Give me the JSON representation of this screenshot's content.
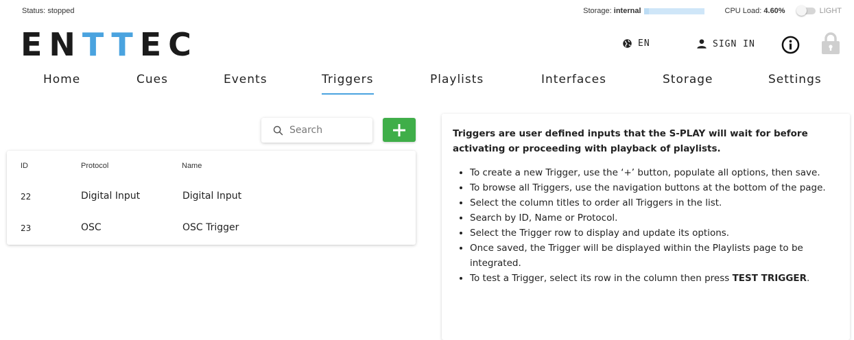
{
  "status": {
    "label": "Status:",
    "value": "stopped",
    "storage_label": "Storage:",
    "storage_value": "internal",
    "storage_fill": 0.08,
    "cpu_label": "CPU Load:",
    "cpu_value": "4.60%",
    "theme_label": "LIGHT"
  },
  "brand": {
    "logo_part1": "EN",
    "logo_part2": "TT",
    "logo_part3": "EC",
    "accent": "#4aa3df"
  },
  "header": {
    "language": "EN",
    "signin_label": "SIGN IN"
  },
  "nav": {
    "tabs": [
      {
        "label": "Home"
      },
      {
        "label": "Cues"
      },
      {
        "label": "Events"
      },
      {
        "label": "Triggers",
        "active": true
      },
      {
        "label": "Playlists"
      },
      {
        "label": "Interfaces"
      },
      {
        "label": "Storage"
      },
      {
        "label": "Settings"
      }
    ]
  },
  "search": {
    "placeholder": "Search"
  },
  "add_button": {
    "icon": "plus-icon",
    "color": "#3fae49"
  },
  "table": {
    "columns": [
      "ID",
      "Protocol",
      "Name"
    ],
    "rows": [
      {
        "id": "22",
        "protocol": "Digital Input",
        "name": "Digital Input"
      },
      {
        "id": "23",
        "protocol": "OSC",
        "name": "OSC Trigger"
      }
    ]
  },
  "info": {
    "intro": "Triggers are user defined inputs that the S-PLAY will wait for before activating or proceeding with playback of playlists.",
    "items": [
      "To create a new Trigger, use the ‘+’ button, populate all options, then save.",
      "To browse all Triggers, use the navigation buttons at the bottom of the page.",
      "Select the column titles to order all Triggers in the list.",
      "Search by ID, Name or Protocol.",
      "Select the Trigger row to display and update its options.",
      "Once saved, the Trigger will be displayed within the Playlists page to be integrated."
    ],
    "last_item_prefix": "To test a Trigger, select its row in the column then press ",
    "last_item_strong": "TEST TRIGGER",
    "last_item_suffix": "."
  }
}
